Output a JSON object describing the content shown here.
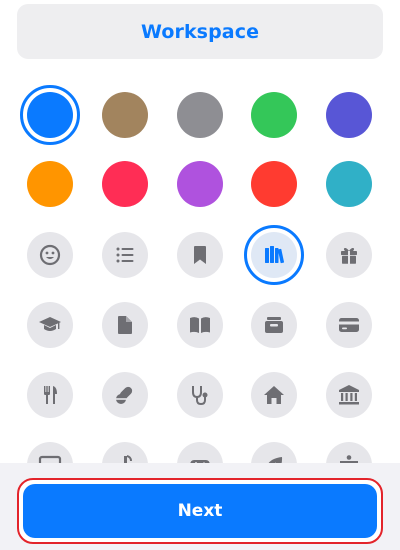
{
  "list_name": {
    "value": "Workspace",
    "accent": "#0a7aff"
  },
  "colors": [
    {
      "name": "blue",
      "hex": "#0a7aff",
      "selected": true
    },
    {
      "name": "brown",
      "hex": "#a2845e",
      "selected": false
    },
    {
      "name": "gray",
      "hex": "#8e8e93",
      "selected": false
    },
    {
      "name": "green",
      "hex": "#34c759",
      "selected": false
    },
    {
      "name": "indigo",
      "hex": "#5856d6",
      "selected": false
    },
    {
      "name": "orange",
      "hex": "#ff9500",
      "selected": false
    },
    {
      "name": "pink",
      "hex": "#ff2d55",
      "selected": false
    },
    {
      "name": "purple",
      "hex": "#af52de",
      "selected": false
    },
    {
      "name": "red",
      "hex": "#ff3b30",
      "selected": false
    },
    {
      "name": "teal",
      "hex": "#30b0c7",
      "selected": false
    }
  ],
  "icons": [
    {
      "name": "smiley-icon",
      "selected": false
    },
    {
      "name": "list-icon",
      "selected": false
    },
    {
      "name": "bookmark-icon",
      "selected": false
    },
    {
      "name": "books-icon",
      "selected": true
    },
    {
      "name": "gift-icon",
      "selected": false
    },
    {
      "name": "graduation-cap-icon",
      "selected": false
    },
    {
      "name": "document-icon",
      "selected": false
    },
    {
      "name": "open-book-icon",
      "selected": false
    },
    {
      "name": "tray-icon",
      "selected": false
    },
    {
      "name": "credit-card-icon",
      "selected": false
    },
    {
      "name": "fork-knife-icon",
      "selected": false
    },
    {
      "name": "pills-icon",
      "selected": false
    },
    {
      "name": "stethoscope-icon",
      "selected": false
    },
    {
      "name": "house-icon",
      "selected": false
    },
    {
      "name": "bank-icon",
      "selected": false
    },
    {
      "name": "tv-icon",
      "selected": false
    },
    {
      "name": "music-note-icon",
      "selected": false
    },
    {
      "name": "gamecontroller-icon",
      "selected": false
    },
    {
      "name": "leaf-icon",
      "selected": false
    },
    {
      "name": "figure-icon",
      "selected": false
    }
  ],
  "next_button": {
    "label": "Next"
  }
}
